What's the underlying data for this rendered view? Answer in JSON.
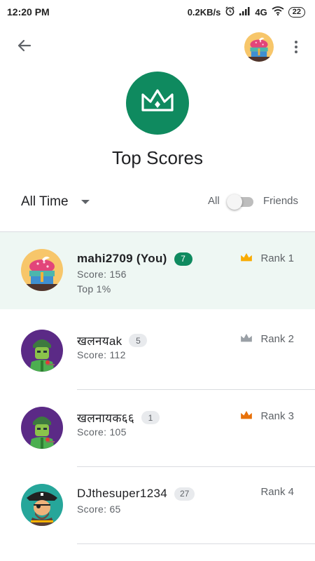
{
  "status_bar": {
    "time": "12:20 PM",
    "speed": "0.2KB/s",
    "network": "4G",
    "battery": "22"
  },
  "app_bar": {
    "back_icon": "arrow-back-icon",
    "avatar_icon": "cupcake-avatar",
    "menu_icon": "more-vert-icon"
  },
  "header": {
    "badge_icon": "crown-icon",
    "title": "Top Scores",
    "accent_color": "#0f8a5f"
  },
  "filters": {
    "time_range": "All Time",
    "toggle_left": "All",
    "toggle_right": "Friends",
    "friends_only": false
  },
  "leaderboard": [
    {
      "name": "mahi2709 (You)",
      "level": "7",
      "score": "Score: 156",
      "top": "Top 1%",
      "rank": "Rank 1",
      "crown_color": "#f9ab00",
      "avatar": "cupcake",
      "is_you": true
    },
    {
      "name": "खलनयak",
      "level": "5",
      "score": "Score: 112",
      "rank": "Rank 2",
      "crown_color": "#9aa0a6",
      "avatar": "green-soldier"
    },
    {
      "name": "खलनायक६६",
      "level": "1",
      "score": "Score: 105",
      "rank": "Rank 3",
      "crown_color": "#e8710a",
      "avatar": "green-soldier"
    },
    {
      "name": "DJthesuper1234",
      "level": "27",
      "score": "Score: 65",
      "rank": "Rank 4",
      "crown_color": "",
      "avatar": "pirate"
    }
  ]
}
